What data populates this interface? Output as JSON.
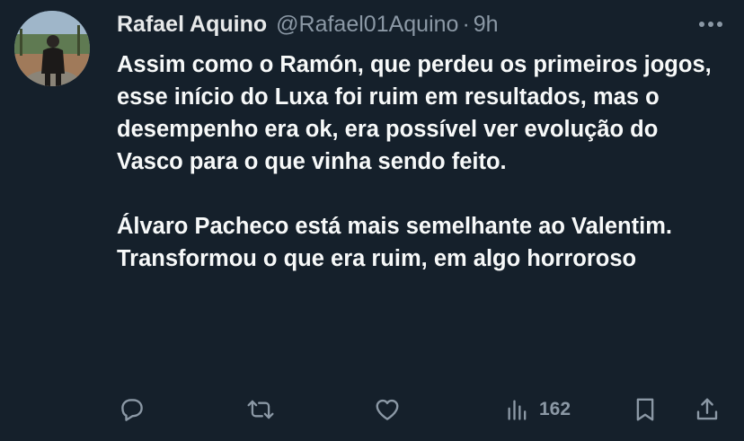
{
  "tweet": {
    "author": {
      "name": "Rafael Aquino",
      "handle": "@Rafael01Aquino",
      "time": "9h"
    },
    "body": {
      "paragraph1": "Assim como o Ramón, que perdeu os primeiros jogos, esse início do Luxa foi ruim em resultados, mas o desempenho era ok, era possível ver evolução do Vasco para o que vinha sendo feito.",
      "paragraph2": "Álvaro Pacheco está mais semelhante ao Valentim. Transformou o que era ruim, em algo horroroso"
    },
    "actions": {
      "reply": {
        "icon": "reply-icon"
      },
      "retweet": {
        "icon": "retweet-icon"
      },
      "like": {
        "icon": "heart-icon"
      },
      "views": {
        "icon": "views-icon",
        "count": "162"
      },
      "bookmark": {
        "icon": "bookmark-icon"
      },
      "share": {
        "icon": "share-icon"
      }
    },
    "colors": {
      "background": "#15202b",
      "text": "#e7e9ea",
      "muted": "#8b98a5"
    }
  }
}
